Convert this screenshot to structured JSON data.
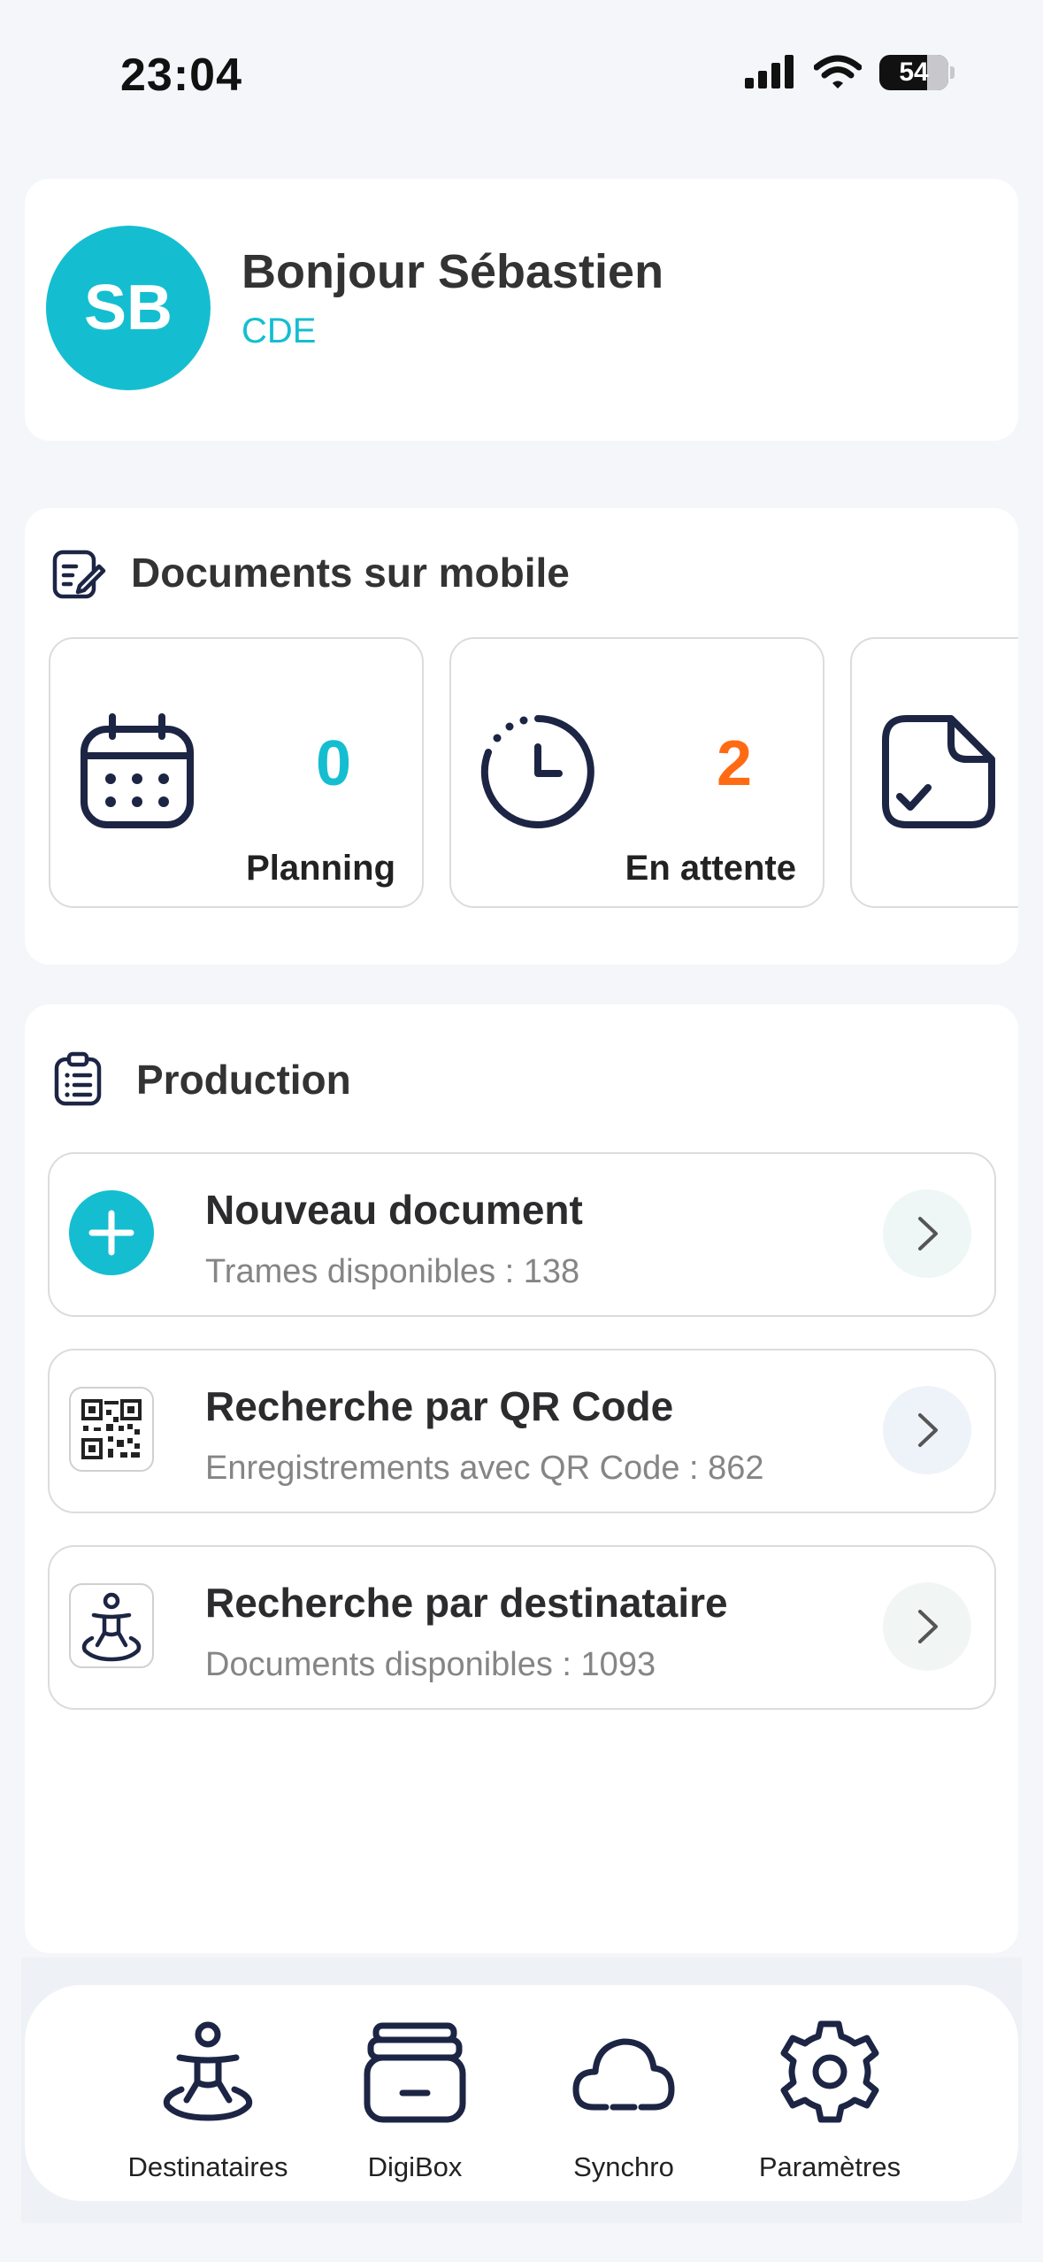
{
  "status_bar": {
    "time": "23:04",
    "battery": "54"
  },
  "profile": {
    "initials": "SB",
    "greeting": "Bonjour Sébastien",
    "role": "CDE"
  },
  "documents": {
    "title": "Documents sur mobile",
    "tiles": [
      {
        "icon": "calendar-icon",
        "value": "0",
        "label": "Planning",
        "color": "#14bed0"
      },
      {
        "icon": "clock-icon",
        "value": "2",
        "label": "En attente",
        "color": "#ff6a13"
      },
      {
        "icon": "document-check-icon"
      }
    ]
  },
  "production": {
    "title": "Production",
    "rows": [
      {
        "icon": "plus-icon",
        "title": "Nouveau document",
        "subtitle": "Trames disponibles : 138"
      },
      {
        "icon": "qr-code-icon",
        "title": "Recherche par QR Code",
        "subtitle": "Enregistrements avec QR Code : 862"
      },
      {
        "icon": "recipient-icon",
        "title": "Recherche par destinataire",
        "subtitle": "Documents disponibles : 1093"
      }
    ]
  },
  "tabbar": {
    "items": [
      {
        "icon": "recipient-icon",
        "label": "Destinataires"
      },
      {
        "icon": "box-icon",
        "label": "DigiBox"
      },
      {
        "icon": "cloud-icon",
        "label": "Synchro"
      },
      {
        "icon": "gear-icon",
        "label": "Paramètres"
      }
    ]
  },
  "colors": {
    "accent": "#14bed0",
    "pending": "#ff6a13",
    "icon": "#1d2544"
  }
}
